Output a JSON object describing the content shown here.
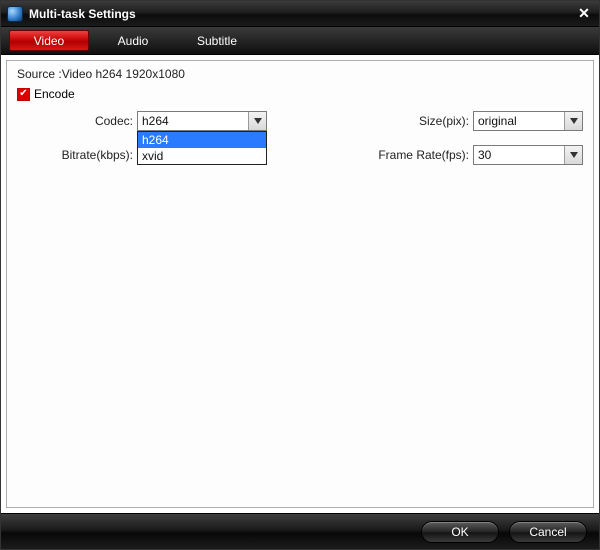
{
  "window": {
    "title": "Multi-task Settings",
    "close_glyph": "✕"
  },
  "tabs": {
    "video": "Video",
    "audio": "Audio",
    "subtitle": "Subtitle"
  },
  "source_line": "Source :Video  h264  1920x1080",
  "encode": {
    "label": "Encode",
    "checked_glyph": "✔"
  },
  "labels": {
    "codec": "Codec:",
    "size": "Size(pix):",
    "bitrate": "Bitrate(kbps):",
    "framerate": "Frame Rate(fps):"
  },
  "values": {
    "codec": "h264",
    "size": "original",
    "bitrate": "",
    "framerate": "30"
  },
  "codec_options": {
    "o0": "h264",
    "o1": "xvid"
  },
  "footer": {
    "ok": "OK",
    "cancel": "Cancel"
  }
}
